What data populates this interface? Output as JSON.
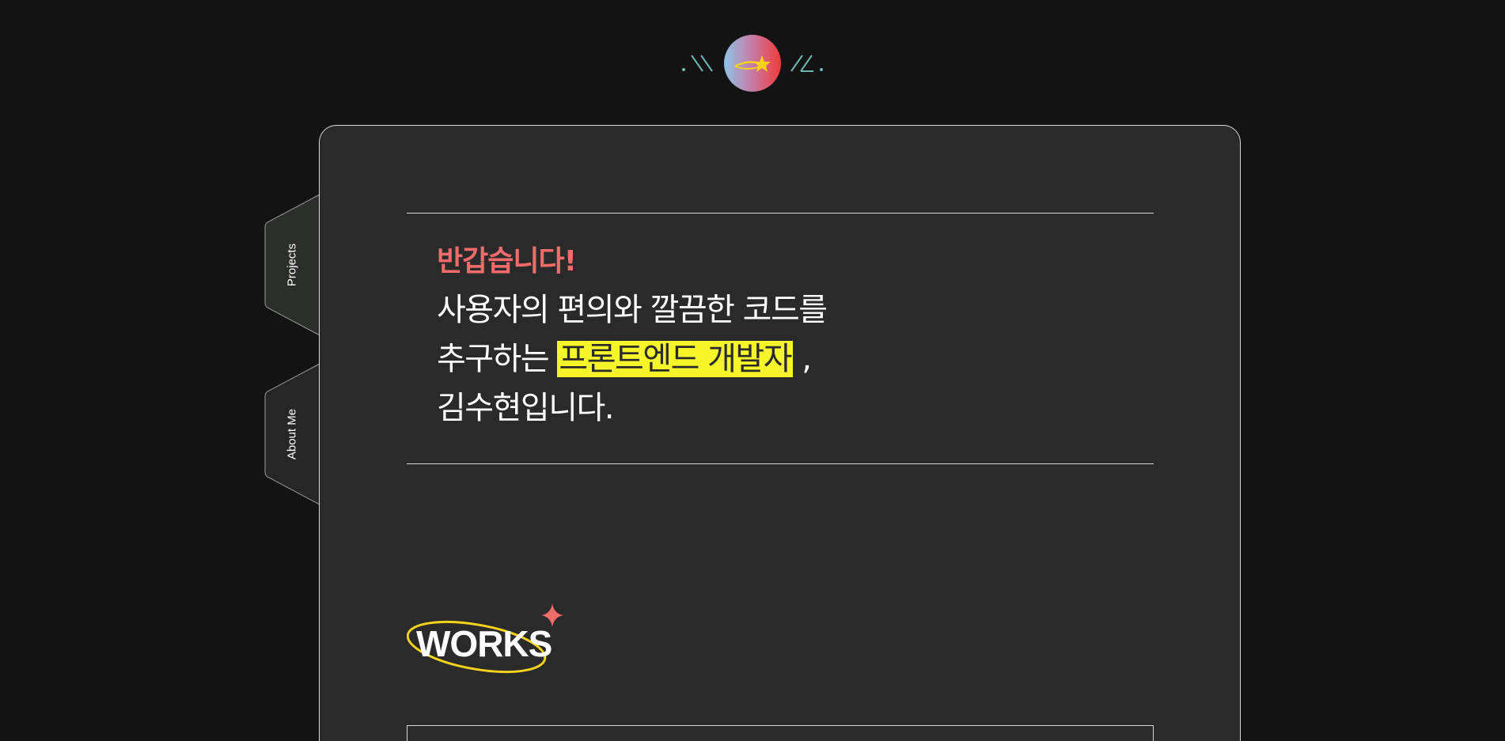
{
  "logo": {
    "icon": "shooting-star-logo-icon",
    "colors": {
      "gradient_start": "#8fc4e8",
      "gradient_end": "#f03a3a",
      "star": "#f5d21c",
      "deco": "#6fb6b0"
    }
  },
  "side_nav": {
    "tabs": [
      {
        "label": "Projects"
      },
      {
        "label": "About Me"
      }
    ]
  },
  "intro": {
    "greeting": "반갑습니다!",
    "line1": "사용자의 편의와 깔끔한 코드를",
    "line2_prefix": "추구하는 ",
    "line2_highlight": "프론트엔드 개발자",
    "line2_suffix": " ,",
    "line3": "김수현입니다."
  },
  "works": {
    "heading": "WORKS",
    "icon": "sparkle-icon"
  },
  "colors": {
    "background": "#131313",
    "card": "#2a2a2a",
    "accent_red": "#f26b6b",
    "highlight_yellow": "#f5f52a",
    "ellipse_yellow": "#f5d21c",
    "border": "#d8d8d8"
  }
}
